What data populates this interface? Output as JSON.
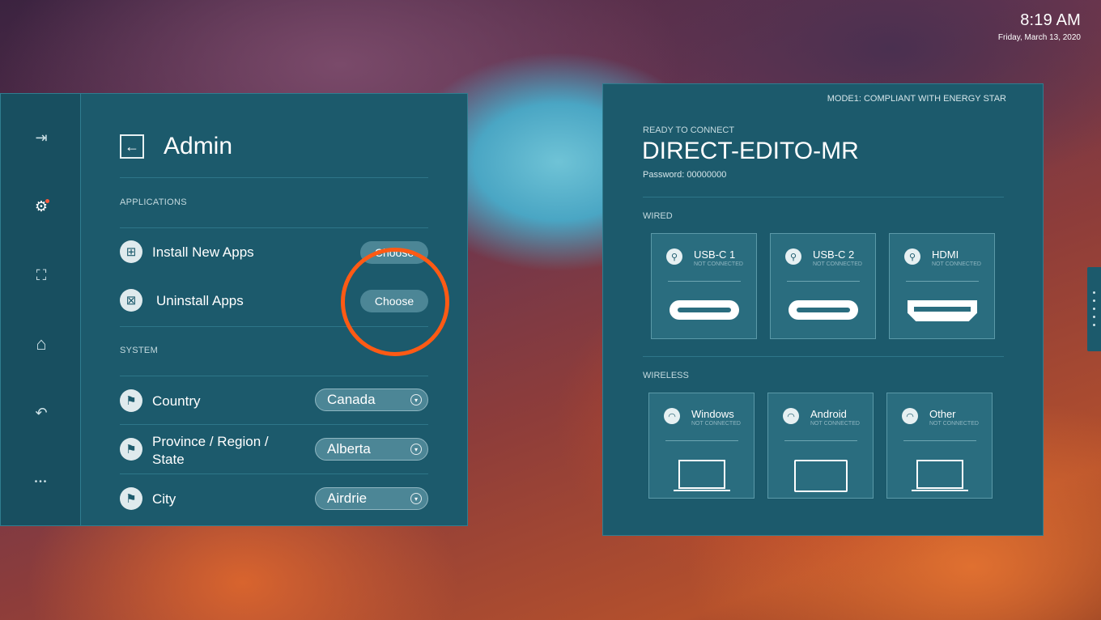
{
  "clock": {
    "time": "8:19 AM",
    "date": "Friday, March 13, 2020"
  },
  "sidebar": {
    "items": [
      {
        "name": "exit-icon",
        "glyph": "⇥"
      },
      {
        "name": "gear-icon",
        "glyph": "⚙"
      },
      {
        "name": "scan-icon",
        "glyph": "⛶"
      },
      {
        "name": "home-icon",
        "glyph": "⌂"
      },
      {
        "name": "undo-icon",
        "glyph": "↶"
      },
      {
        "name": "more-icon",
        "glyph": "•••"
      }
    ]
  },
  "admin": {
    "title": "Admin",
    "back_glyph": "←",
    "applications_label": "APPLICATIONS",
    "install_label": "Install New Apps",
    "install_icon": "⊞",
    "install_button": "Choose",
    "uninstall_label": "Uninstall Apps",
    "uninstall_icon": "⊠",
    "uninstall_button": "Choose",
    "system_label": "SYSTEM",
    "country_label": "Country",
    "country_value": "Canada",
    "province_label": "Province / Region / State",
    "province_value": "Alberta",
    "city_label": "City",
    "city_value": "Airdrie",
    "flag_icon": "⚑",
    "chevron": "▾"
  },
  "connect": {
    "mode": "MODE1: COMPLIANT WITH ENERGY STAR",
    "ready_label": "READY TO CONNECT",
    "device_name": "DIRECT-EDITO-MR",
    "password": "Password: 00000000",
    "wired_label": "WIRED",
    "wireless_label": "WIRELESS",
    "wired": [
      {
        "name": "USB-C 1",
        "status": "NOT CONNECTED",
        "icon": "⚲"
      },
      {
        "name": "USB-C 2",
        "status": "NOT CONNECTED",
        "icon": "⚲"
      },
      {
        "name": "HDMI",
        "status": "NOT CONNECTED",
        "icon": "⚲"
      }
    ],
    "wireless": [
      {
        "name": "Windows",
        "status": "NOT CONNECTED",
        "icon": "◠"
      },
      {
        "name": "Android",
        "status": "NOT CONNECTED",
        "icon": "◠"
      },
      {
        "name": "Other",
        "status": "NOT CONNECTED",
        "icon": "◠"
      }
    ]
  }
}
